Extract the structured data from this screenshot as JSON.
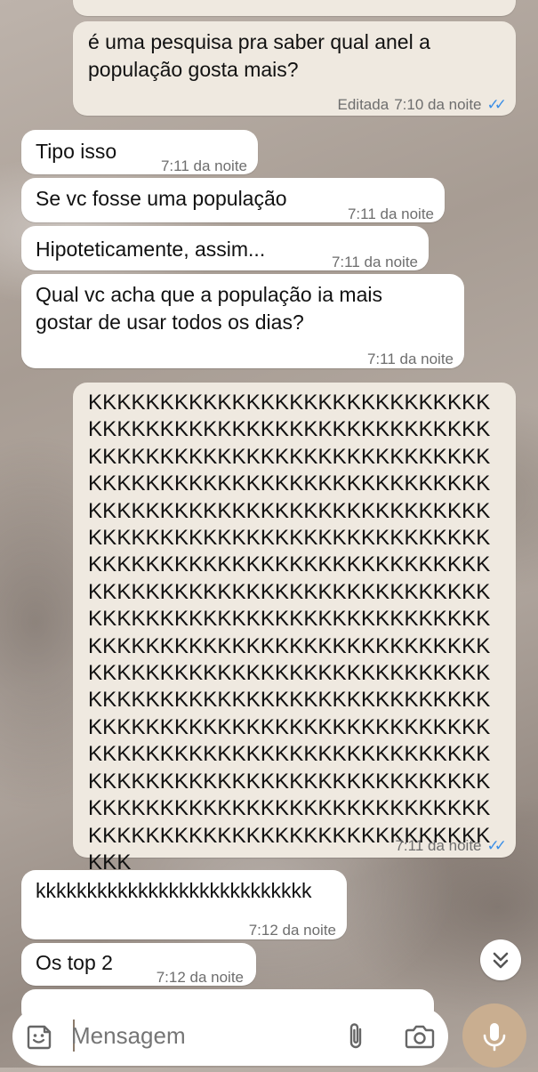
{
  "colors": {
    "incoming_bubble": "#ffffff",
    "outgoing_bubble": "#efe9e0",
    "read_ticks": "#3a8ee6",
    "mic_button": "#c9ae90"
  },
  "messages": [
    {
      "direction": "outgoing",
      "text": "é uma pesquisa pra saber qual anel a\npopulação gosta mais?",
      "edited_label": "Editada",
      "time": "7:10 da noite",
      "status": "read"
    },
    {
      "direction": "incoming",
      "text": "Tipo isso",
      "time": "7:11 da noite"
    },
    {
      "direction": "incoming",
      "text": "Se vc fosse uma população",
      "time": "7:11 da noite"
    },
    {
      "direction": "incoming",
      "text": "Hipoteticamente, assim...",
      "time": "7:11 da noite"
    },
    {
      "direction": "incoming",
      "text": "Qual vc acha que a população ia mais\ngostar de usar todos os dias?",
      "time": "7:11 da noite"
    },
    {
      "direction": "outgoing",
      "text": "KKKKKKKKKKKKKKKKKKKKKKKKKKKKKKKKKKKKKKKKKKKKKKKKKKKKKKKKKKKKKKKKKKKKKKKKKKKKKKKKKKKKKKKKKKKKKKKKKKKKKKKKKKKKKKKKKKKKKKKKKKKKKKKKKKKKKKKKKKKKKKKKKKKKKKKKKKKKKKKKKKKKKKKKKKKKKKKKKKKKKKKKKKKKKKKKKKKKKKKKKKKKKKKKKKKKKKKKKKKKKKKKKKKKKKKKKKKKKKKKKKKKKKKKKKKKKKKKKKKKKKKKKKKKKKKKKKKKKKKKKKKKKKKKKKKKKKKKKKKKKKKKKKKKKKKKKKKKKKKKKKKKKKKKKKKKKKKKKKKKKKKKKKKKKKKKKKKKKKKKKKKKKKKKKKKKKKKKKKKKKKKKKKKKKKKKKKKKKKKKKKKKKKKKKKKKKKKKKKKKKKKKKKKKKKKKKKKKKKKKKKKKKKKKKKKKKKKKKKKKKKKKKKKKKKKKKKKKKKK",
      "time": "7:11 da noite",
      "status": "read"
    },
    {
      "direction": "incoming",
      "text": "kkkkkkkkkkkkkkkkkkkkkkkkkkk",
      "time": "7:12 da noite"
    },
    {
      "direction": "incoming",
      "text": "Os top 2",
      "time": "7:12 da noite"
    }
  ],
  "composer": {
    "placeholder": "Mensagem",
    "emoji_icon": "sticker-emoji-icon",
    "attach_icon": "paperclip-icon",
    "camera_icon": "camera-icon",
    "mic_icon": "microphone-icon"
  },
  "scroll_down_icon": "double-chevron-down-icon"
}
